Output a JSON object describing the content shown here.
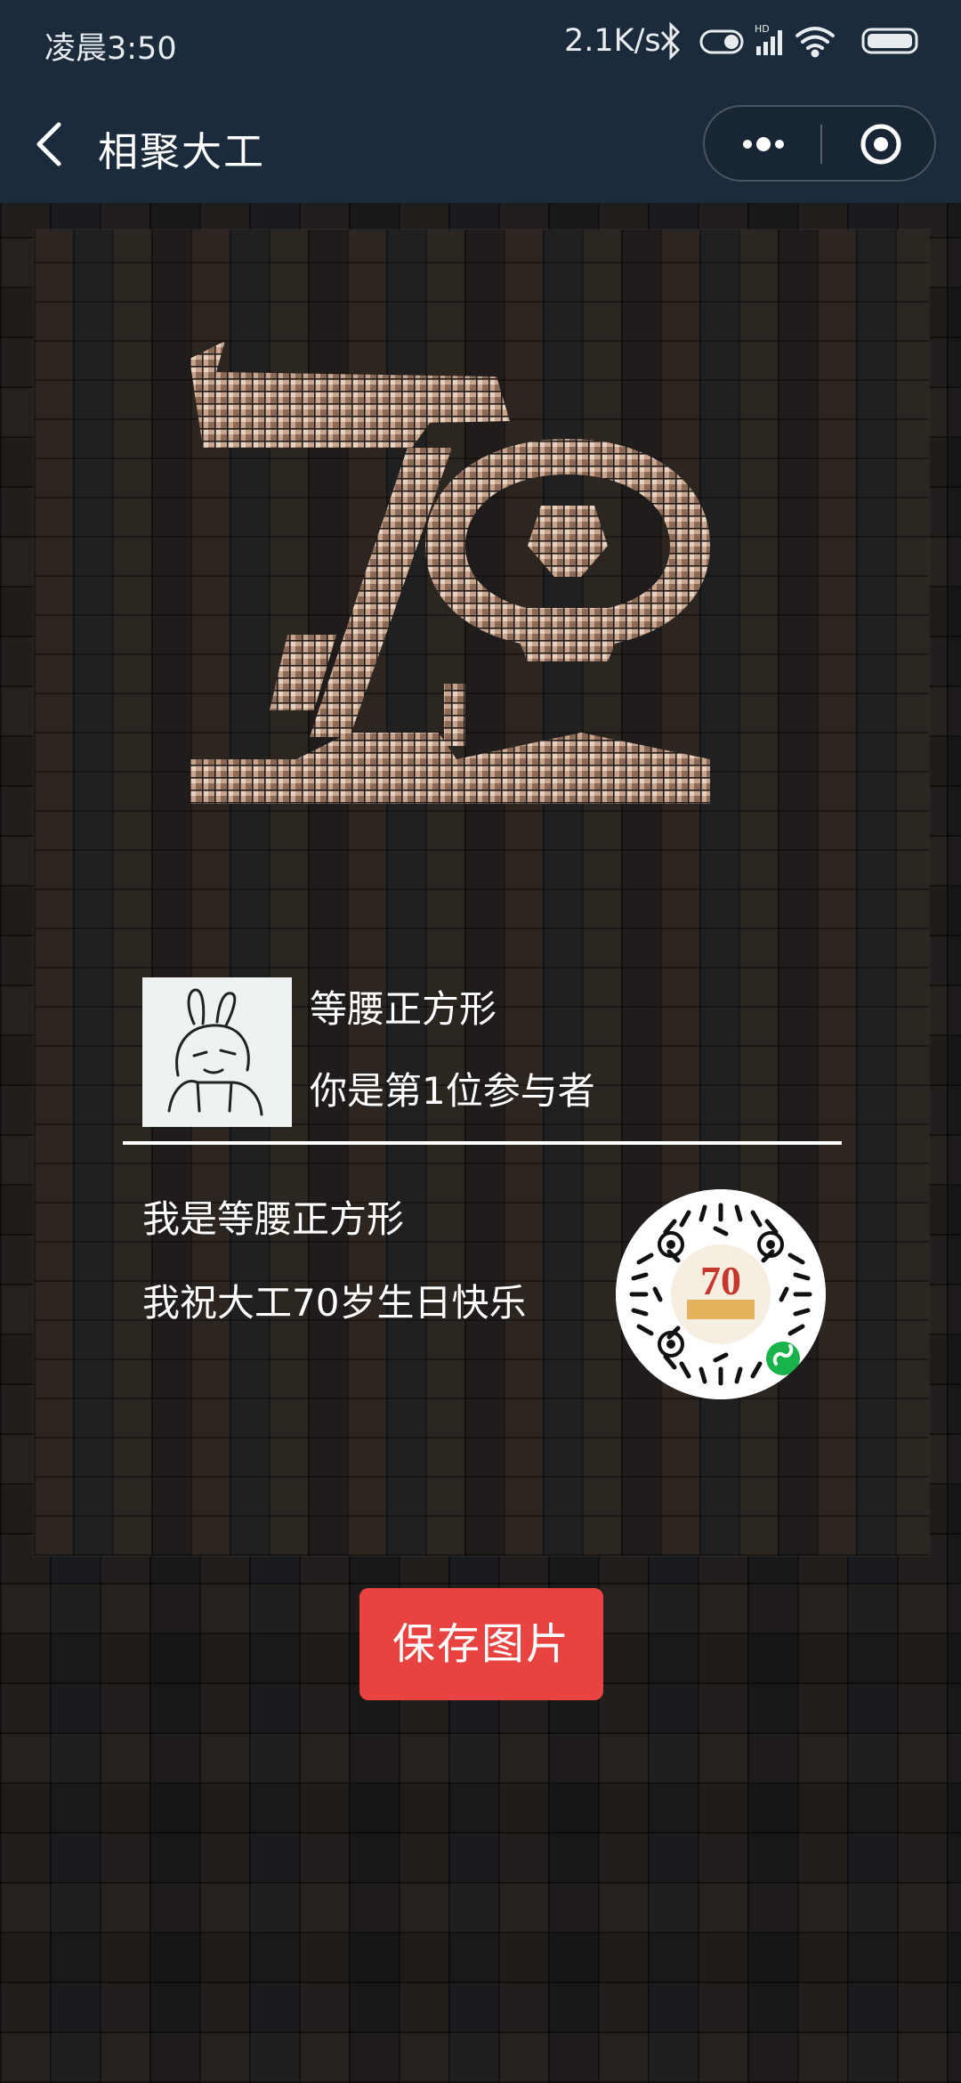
{
  "status_bar": {
    "time": "凌晨3:50",
    "network_speed": "2.1K/s",
    "icons": [
      "bluetooth-icon",
      "toggle-icon",
      "hd-signal-icon",
      "wifi-icon",
      "battery-icon"
    ]
  },
  "nav": {
    "title": "相聚大工",
    "back_icon": "chevron-left-icon",
    "more_icon": "more-dots-icon",
    "close_icon": "target-circle-icon"
  },
  "poster": {
    "logo_icon": "anniversary-70-mosaic-logo",
    "avatar_icon": "rabbit-avatar-icon",
    "user_name": "等腰正方形",
    "participant_rank": "你是第1位参与者",
    "wish_line1": "我是等腰正方形",
    "wish_line2": "我祝大工70岁生日快乐",
    "qr_icon": "mini-program-code-icon"
  },
  "actions": {
    "save_label": "保存图片"
  },
  "colors": {
    "header_bg": "#1c2b3c",
    "save_button_bg": "#e84340"
  }
}
